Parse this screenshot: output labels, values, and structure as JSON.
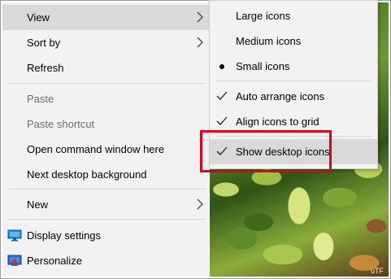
{
  "context_menu": {
    "items": [
      {
        "label": "View",
        "disabled": false,
        "has_submenu": true,
        "highlighted": true
      },
      {
        "label": "Sort by",
        "disabled": false,
        "has_submenu": true
      },
      {
        "label": "Refresh",
        "disabled": false
      },
      {
        "label": "Paste",
        "disabled": true
      },
      {
        "label": "Paste shortcut",
        "disabled": true
      },
      {
        "label": "Open command window here",
        "disabled": false
      },
      {
        "label": "Next desktop background",
        "disabled": false
      },
      {
        "label": "New",
        "disabled": false,
        "has_submenu": true
      },
      {
        "label": "Display settings",
        "disabled": false,
        "icon": "display-icon"
      },
      {
        "label": "Personalize",
        "disabled": false,
        "icon": "personalize-icon"
      }
    ]
  },
  "view_submenu": {
    "items": [
      {
        "label": "Large icons",
        "mark": "none"
      },
      {
        "label": "Medium icons",
        "mark": "none"
      },
      {
        "label": "Small icons",
        "mark": "bullet"
      },
      {
        "label": "Auto arrange icons",
        "mark": "check"
      },
      {
        "label": "Align icons to grid",
        "mark": "check"
      },
      {
        "label": "Show desktop icons",
        "mark": "check",
        "highlighted": true
      }
    ]
  },
  "watermark": "uTF",
  "colors": {
    "menu_bg": "#f2f2f2",
    "highlight": "#d9d9d9",
    "annotation_box": "#e0001a",
    "disabled_text": "#6d6d6d"
  }
}
